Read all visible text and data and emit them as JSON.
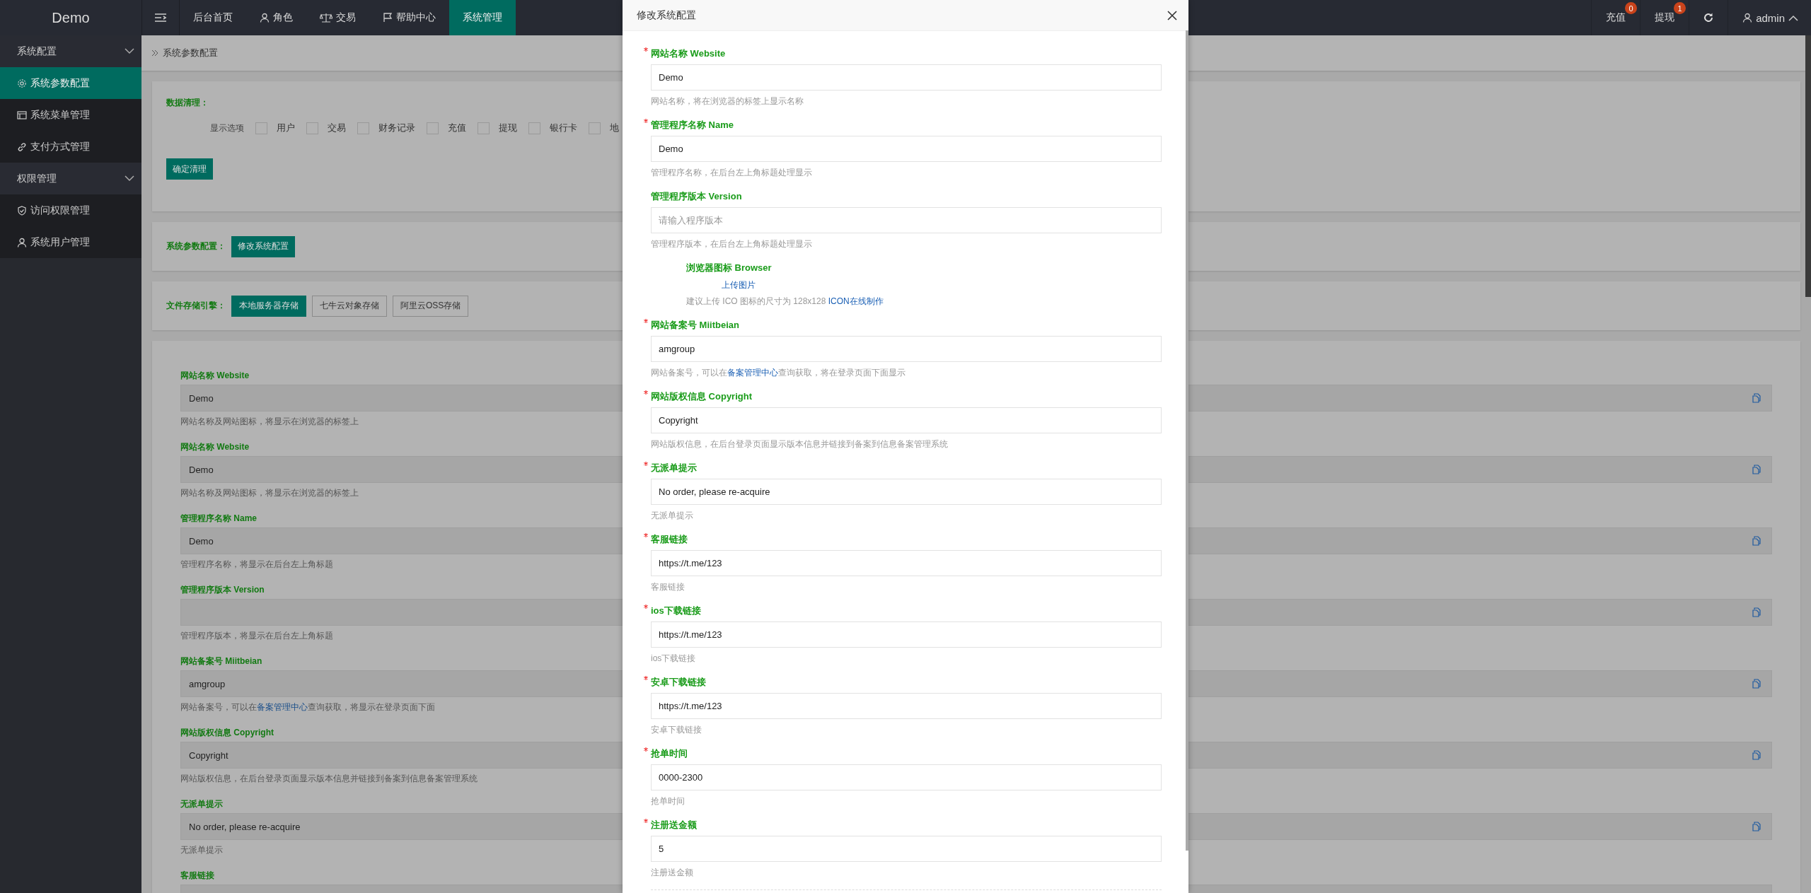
{
  "topbar": {
    "logo": "Demo",
    "nav": [
      {
        "label": "后台首页",
        "selected": false
      },
      {
        "label": "角色",
        "selected": false
      },
      {
        "label": "交易",
        "selected": false
      },
      {
        "label": "帮助中心",
        "selected": false
      },
      {
        "label": "系统管理",
        "selected": true
      }
    ],
    "actions": [
      {
        "label": "充值",
        "badge": "0"
      },
      {
        "label": "提现",
        "badge": "1"
      }
    ],
    "user": "admin"
  },
  "sidebar": [
    {
      "label": "系统配置",
      "expanded": true,
      "items": [
        {
          "label": "系统参数配置",
          "selected": true
        },
        {
          "label": "系统菜单管理",
          "selected": false
        },
        {
          "label": "支付方式管理",
          "selected": false
        }
      ]
    },
    {
      "label": "权限管理",
      "expanded": true,
      "items": [
        {
          "label": "访问权限管理",
          "selected": false
        },
        {
          "label": "系统用户管理",
          "selected": false
        }
      ]
    }
  ],
  "breadcrumb": "系统参数配置",
  "cleanup": {
    "title": "数据清理：",
    "options_label": "显示选项",
    "options": [
      {
        "label": "用户",
        "checked": false
      },
      {
        "label": "交易",
        "checked": false
      },
      {
        "label": "财务记录",
        "checked": false
      },
      {
        "label": "充值",
        "checked": false
      },
      {
        "label": "提现",
        "checked": false
      },
      {
        "label": "银行卡",
        "checked": false
      },
      {
        "label": "地",
        "checked": false
      }
    ],
    "button": "确定清理"
  },
  "config": {
    "label": "系统参数配置：",
    "button": "修改系统配置"
  },
  "storage": {
    "label": "文件存储引擎：",
    "options": [
      {
        "label": "本地服务器存储",
        "selected": true
      },
      {
        "label": "七牛云对象存储",
        "selected": false
      },
      {
        "label": "阿里云OSS存储",
        "selected": false
      }
    ]
  },
  "settings": [
    {
      "label": "网站名称 Website",
      "value": "Demo",
      "hint": "网站名称及网站图标，将显示在浏览器的标签上"
    },
    {
      "label": "网站名称 Website",
      "value": "Demo",
      "hint": "网站名称及网站图标，将显示在浏览器的标签上"
    },
    {
      "label": "管理程序名称 Name",
      "value": "Demo",
      "hint": "管理程序名称，将显示在后台左上角标题"
    },
    {
      "label": "管理程序版本 Version",
      "hint": "管理程序版本，将显示在后台左上角标题"
    },
    {
      "label": "网站备案号 Miitbeian",
      "value": "amgroup",
      "hint": "网站备案号，可以在",
      "hint_link": "备案管理中心",
      "hint_after": "查询获取，将显示在登录页面下面"
    },
    {
      "label": "网站版权信息 Copyright",
      "value": "Copyright",
      "hint": "网站版权信息，在后台登录页面显示版本信息并链接到备案到信息备案管理系统"
    },
    {
      "label": "无派单提示",
      "value": "No order, please re-acquire",
      "hint": "无派单提示"
    },
    {
      "label": "客服链接"
    }
  ],
  "modal": {
    "title": "修改系统配置",
    "fields": [
      {
        "kind": "input",
        "required": true,
        "label": "网站名称 Website",
        "value": "Demo",
        "hint": "网站名称，将在浏览器的标签上显示名称"
      },
      {
        "kind": "input",
        "required": true,
        "label": "管理程序名称 Name",
        "value": "Demo",
        "hint": "管理程序名称，在后台左上角标题处理显示"
      },
      {
        "kind": "input",
        "required": false,
        "label": "管理程序版本 Version",
        "placeholder": "请输入程序版本",
        "hint": "管理程序版本，在后台左上角标题处理显示"
      },
      {
        "kind": "upload",
        "required": false,
        "label": "浏览器图标 Browser",
        "button": "上传图片",
        "hint": "建议上传 ICO 图标的尺寸为 128x128 ",
        "hint_link": "ICON在线制作"
      },
      {
        "kind": "input",
        "required": true,
        "label": "网站备案号 Miitbeian",
        "value": "amgroup",
        "hint": "网站备案号，可以在",
        "hint_link": "备案管理中心",
        "hint_after": "查询获取，将在登录页面下面显示"
      },
      {
        "kind": "input",
        "required": true,
        "label": "网站版权信息 Copyright",
        "value": "Copyright",
        "hint": "网站版权信息，在后台登录页面显示版本信息并链接到备案到信息备案管理系统"
      },
      {
        "kind": "input",
        "required": true,
        "label": "无派单提示",
        "value": "No order, please re-acquire",
        "hint": "无派单提示"
      },
      {
        "kind": "input",
        "required": true,
        "label": "客服链接",
        "value": "https://t.me/123",
        "hint": "客服链接"
      },
      {
        "kind": "input",
        "required": true,
        "label": "ios下载链接",
        "value": "https://t.me/123",
        "hint": "ios下载链接"
      },
      {
        "kind": "input",
        "required": true,
        "label": "安卓下载链接",
        "value": "https://t.me/123",
        "hint": "安卓下载链接"
      },
      {
        "kind": "input",
        "required": true,
        "label": "抢单时间",
        "value": "0000-2300",
        "hint": "抢单时间"
      },
      {
        "kind": "input",
        "required": true,
        "label": "注册送金额",
        "value": "5",
        "hint": "注册送金额"
      }
    ]
  }
}
